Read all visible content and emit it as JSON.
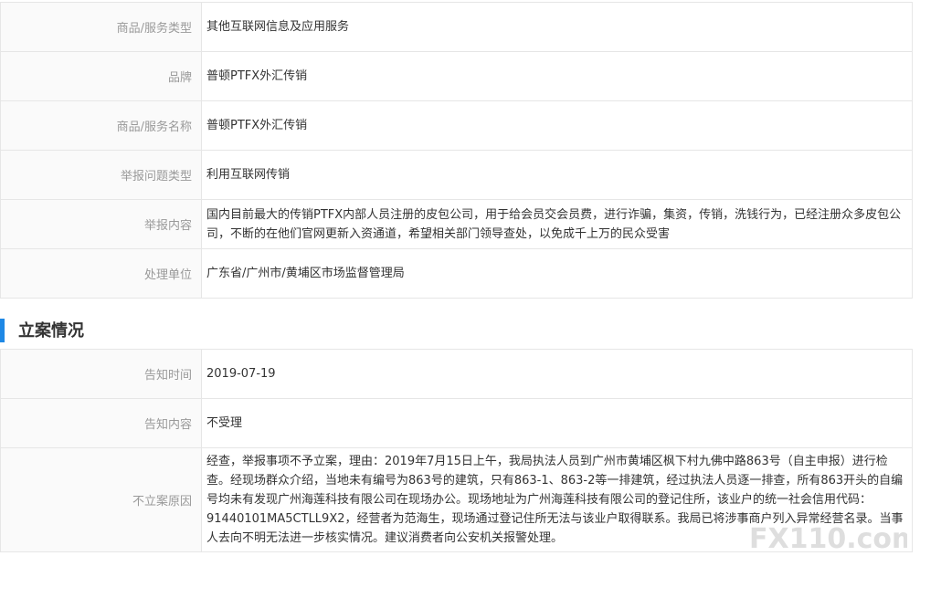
{
  "complaint": {
    "rows": [
      {
        "label": "商品/服务类型",
        "value": "其他互联网信息及应用服务"
      },
      {
        "label": "品牌",
        "value": "普顿PTFX外汇传销"
      },
      {
        "label": "商品/服务名称",
        "value": "普顿PTFX外汇传销"
      },
      {
        "label": "举报问题类型",
        "value": "利用互联网传销"
      },
      {
        "label": "举报内容",
        "value": "国内目前最大的传销PTFX内部人员注册的皮包公司，用于给会员交会员费，进行诈骗，集资，传销，洗钱行为，已经注册众多皮包公司，不断的在他们官网更新入资通道，希望相关部门领导查处，以免成千上万的民众受害"
      },
      {
        "label": "处理单位",
        "value": "广东省/广州市/黄埔区市场监督管理局"
      }
    ]
  },
  "case": {
    "title": "立案情况",
    "rows": [
      {
        "label": "告知时间",
        "value": "2019-07-19"
      },
      {
        "label": "告知内容",
        "value": "不受理"
      },
      {
        "label": "不立案原因",
        "value": "经查，举报事项不予立案，理由：2019年7月15日上午，我局执法人员到广州市黄埔区枫下村九佛中路863号（自主申报）进行检查。经现场群众介绍，当地未有编号为863号的建筑，只有863-1、863-2等一排建筑，经过执法人员逐一排查，所有863开头的自编号均未有发现广州海莲科技有限公司在现场办公。现场地址为广州海莲科技有限公司的登记住所，该业户的统一社会信用代码：91440101MA5CTLL9X2，经营者为范海生，现场通过登记住所无法与该业户取得联系。我局已将涉事商户列入异常经营名录。当事人去向不明无法进一步核实情况。建议消费者向公安机关报警处理。"
      }
    ]
  },
  "watermark": {
    "text": "FX110.com"
  }
}
